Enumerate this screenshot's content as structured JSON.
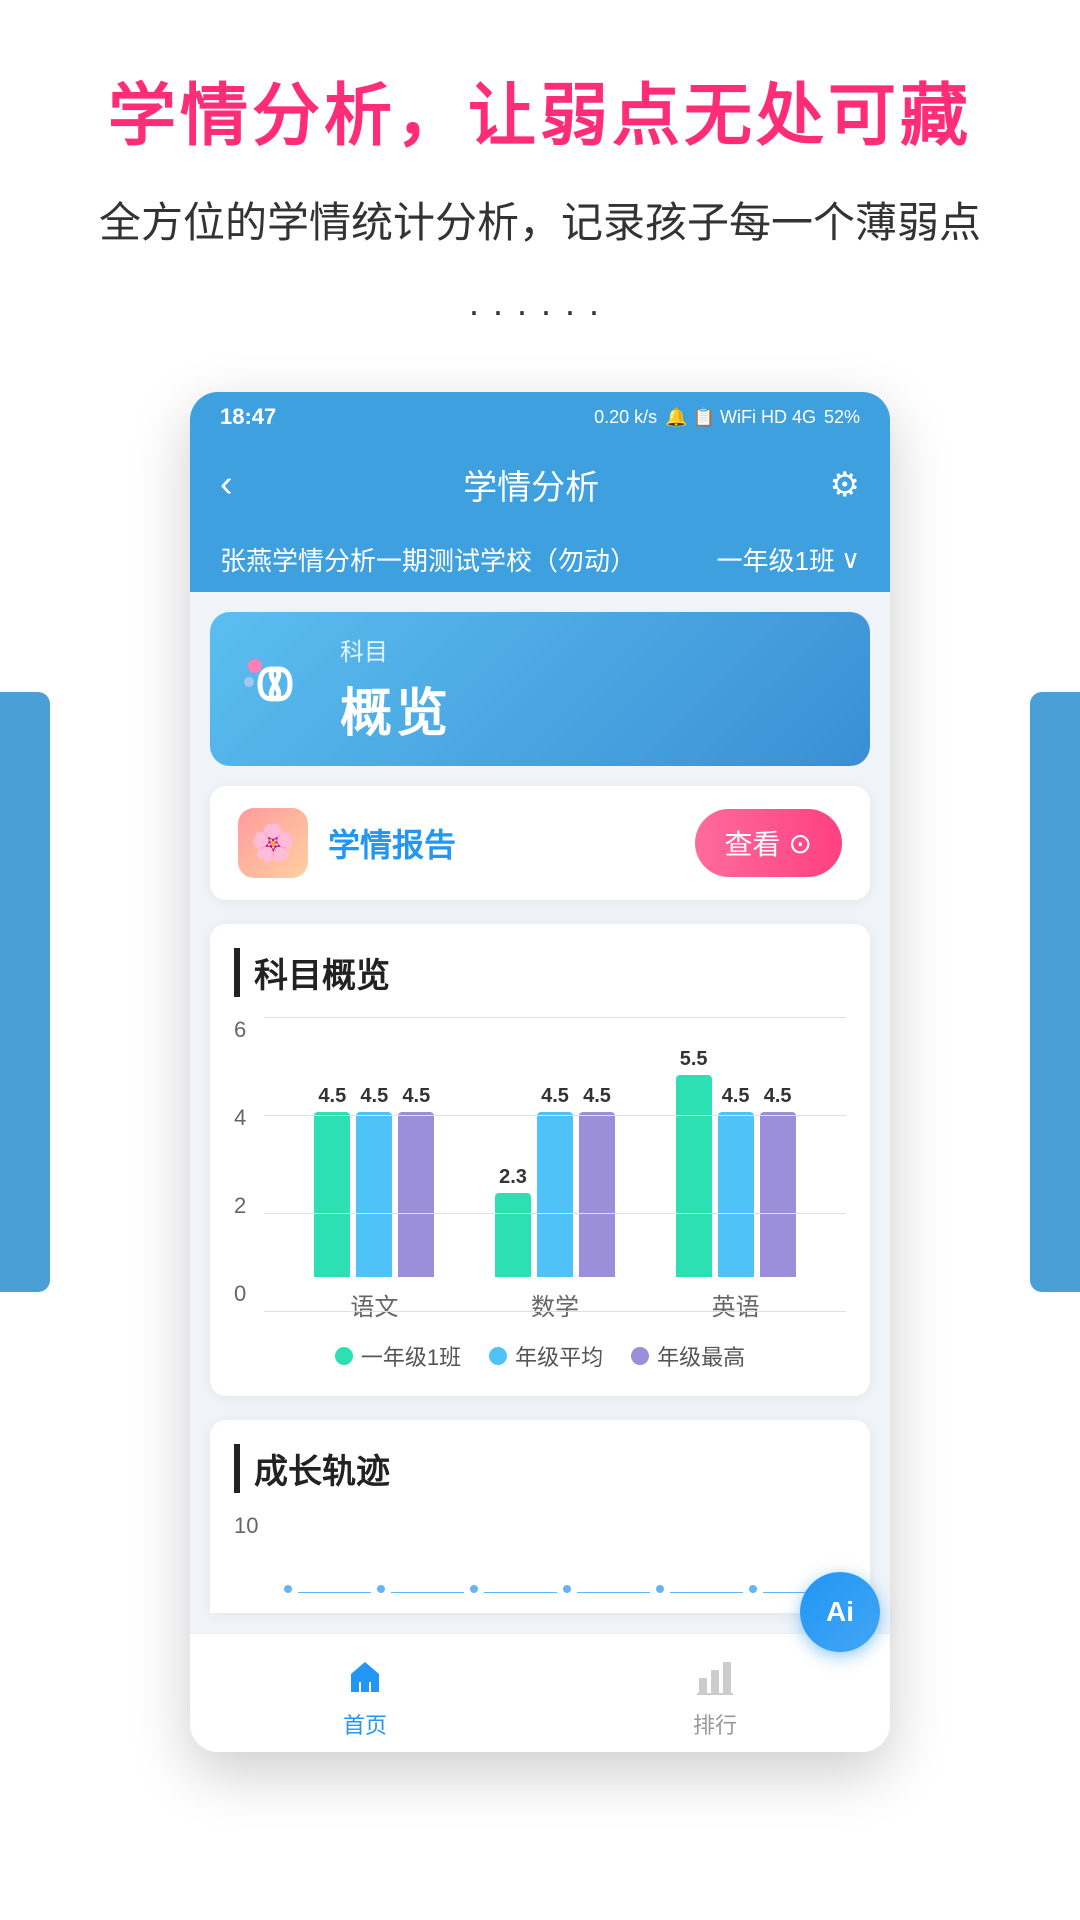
{
  "page": {
    "main_title": "学情分析，让弱点无处可藏",
    "sub_title": "全方位的学情统计分析，记录孩子每一个薄弱点",
    "dots": "······"
  },
  "status_bar": {
    "time": "18:47",
    "network": "0.20 k/s",
    "icons": "🔔 📋",
    "signal": "HD 4G HD 4G",
    "battery": "52%"
  },
  "header": {
    "back": "‹",
    "title": "学情分析",
    "settings": "⚙"
  },
  "school_bar": {
    "school_name": "张燕学情分析一期测试学校（勿动）",
    "class": "一年级1班",
    "chevron": "∨"
  },
  "subject_tab": {
    "label": "科目",
    "value": "概览"
  },
  "report": {
    "title": "学情报告",
    "view_btn": "查看",
    "view_arrow": "⊙"
  },
  "chart_section": {
    "title": "科目概览",
    "y_labels": [
      "0",
      "2",
      "4",
      "6"
    ],
    "subjects": [
      {
        "name": "语文",
        "bars": [
          {
            "label": "一年级1班",
            "value": 4.5,
            "color": "green"
          },
          {
            "label": "年级平均",
            "value": 4.5,
            "color": "lightblue"
          },
          {
            "label": "年级最高",
            "value": 4.5,
            "color": "purple"
          }
        ]
      },
      {
        "name": "数学",
        "bars": [
          {
            "label": "一年级1班",
            "value": 2.3,
            "color": "green"
          },
          {
            "label": "年级平均",
            "value": 4.5,
            "color": "lightblue"
          },
          {
            "label": "年级最高",
            "value": 4.5,
            "color": "purple"
          }
        ]
      },
      {
        "name": "英语",
        "bars": [
          {
            "label": "一年级1班",
            "value": 5.5,
            "color": "green"
          },
          {
            "label": "年级平均",
            "value": 4.5,
            "color": "lightblue"
          },
          {
            "label": "年级最高",
            "value": 4.5,
            "color": "purple"
          }
        ]
      }
    ],
    "legend": [
      {
        "label": "一年级1班",
        "color": "#2de0b4"
      },
      {
        "label": "年级平均",
        "color": "#4fc3f7"
      },
      {
        "label": "年级最高",
        "color": "#9c8fda"
      }
    ]
  },
  "growth_section": {
    "title": "成长轨迹",
    "y_label": "10"
  },
  "bottom_nav": {
    "items": [
      {
        "label": "首页",
        "active": true,
        "icon": "🏠"
      },
      {
        "label": "排行",
        "active": false,
        "icon": "📊"
      }
    ]
  },
  "ai_badge": {
    "label": "Ai"
  }
}
